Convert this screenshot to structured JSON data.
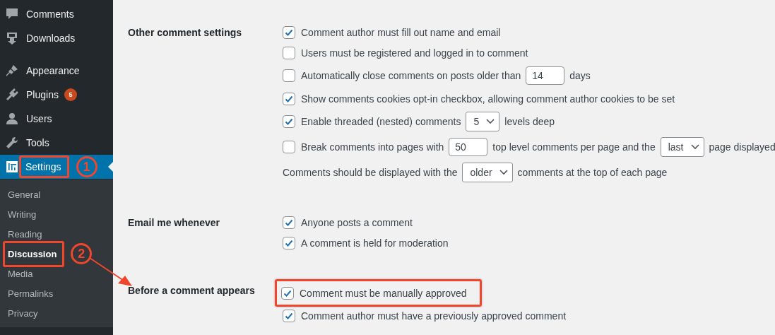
{
  "sidebar": {
    "menu_groups": [
      [
        {
          "label": "Comments",
          "selected": false
        },
        {
          "label": "Downloads",
          "selected": false
        }
      ],
      [
        {
          "label": "Appearance",
          "selected": false
        },
        {
          "label": "Plugins",
          "selected": false,
          "badge": "5"
        },
        {
          "label": "Users",
          "selected": false
        },
        {
          "label": "Tools",
          "selected": false
        },
        {
          "label": "Settings",
          "selected": true,
          "callout": "1"
        }
      ]
    ],
    "submenu": [
      {
        "label": "General",
        "selected": false
      },
      {
        "label": "Writing",
        "selected": false
      },
      {
        "label": "Reading",
        "selected": false
      },
      {
        "label": "Discussion",
        "selected": true,
        "callout": "2",
        "pointer_arrow": true
      },
      {
        "label": "Media",
        "selected": false
      },
      {
        "label": "Permalinks",
        "selected": false
      },
      {
        "label": "Privacy",
        "selected": false
      }
    ]
  },
  "sections": [
    {
      "label": "Other comment settings",
      "options": [
        {
          "kind": "checkbox",
          "checked": true,
          "parts": [
            {
              "kind": "text",
              "text": "Comment author must fill out name and email"
            }
          ]
        },
        {
          "kind": "checkbox",
          "checked": false,
          "parts": [
            {
              "kind": "text",
              "text": "Users must be registered and logged in to comment"
            }
          ]
        },
        {
          "kind": "checkbox",
          "checked": false,
          "parts": [
            {
              "kind": "text",
              "text": "Automatically close comments on posts older than"
            },
            {
              "kind": "input",
              "value": "14"
            },
            {
              "kind": "text",
              "text": "days"
            }
          ]
        },
        {
          "kind": "checkbox",
          "checked": true,
          "parts": [
            {
              "kind": "text",
              "text": "Show comments cookies opt-in checkbox, allowing comment author cookies to be set"
            }
          ]
        },
        {
          "kind": "checkbox",
          "checked": true,
          "parts": [
            {
              "kind": "text",
              "text": "Enable threaded (nested) comments"
            },
            {
              "kind": "select",
              "value": "5"
            },
            {
              "kind": "text",
              "text": "levels deep"
            }
          ]
        },
        {
          "kind": "checkbox",
          "checked": false,
          "parts": [
            {
              "kind": "text",
              "text": "Break comments into pages with"
            },
            {
              "kind": "input",
              "value": "50"
            },
            {
              "kind": "text",
              "text": "top level comments per page and the"
            },
            {
              "kind": "select",
              "value": "last"
            },
            {
              "kind": "text",
              "text": "page displayed"
            }
          ]
        },
        {
          "kind": "plain",
          "parts": [
            {
              "kind": "text",
              "text": "Comments should be displayed with the"
            },
            {
              "kind": "select",
              "value": "older"
            },
            {
              "kind": "text",
              "text": "comments at the top of each page"
            }
          ]
        }
      ]
    },
    {
      "label": "Email me whenever",
      "options": [
        {
          "kind": "checkbox",
          "checked": true,
          "parts": [
            {
              "kind": "text",
              "text": "Anyone posts a comment"
            }
          ]
        },
        {
          "kind": "checkbox",
          "checked": true,
          "parts": [
            {
              "kind": "text",
              "text": "A comment is held for moderation"
            }
          ]
        }
      ]
    },
    {
      "label": "Before a comment appears",
      "options": [
        {
          "kind": "checkbox",
          "checked": true,
          "highlighted": true,
          "parts": [
            {
              "kind": "text",
              "text": "Comment must be manually approved"
            }
          ]
        },
        {
          "kind": "checkbox",
          "checked": true,
          "parts": [
            {
              "kind": "text",
              "text": "Comment author must have a previously approved comment"
            }
          ]
        }
      ]
    }
  ]
}
